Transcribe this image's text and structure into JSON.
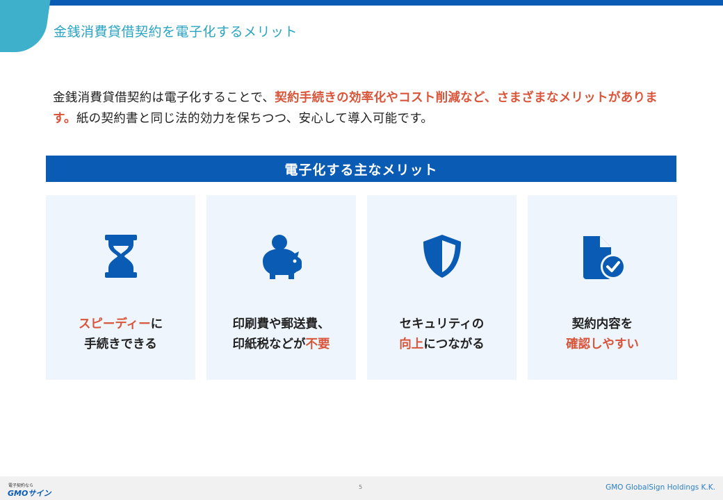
{
  "slide": {
    "title": "金銭消費貸借契約を電子化するメリット"
  },
  "intro": {
    "part1": "金銭消費貸借契約は電子化することで、",
    "highlight": "契約手続きの効率化やコスト削減など、さまざまなメリットがあります。",
    "part2": "紙の契約書と同じ法的効力を保ちつつ、安心して導入可能です。"
  },
  "section": {
    "heading": "電子化する主なメリット"
  },
  "cards": [
    {
      "icon": "hourglass-icon",
      "line1_hl": "スピーディー",
      "line1_rest": "に",
      "line2": "手続きできる"
    },
    {
      "icon": "piggy-bank-icon",
      "line1": "印刷費や郵送費、",
      "line2_pre": "印紙税などが",
      "line2_hl": "不要"
    },
    {
      "icon": "shield-icon",
      "line1": "セキュリティの",
      "line2_hl": "向上",
      "line2_rest": "につながる"
    },
    {
      "icon": "document-check-icon",
      "line1": "契約内容を",
      "line2_hl": "確認しやすい"
    }
  ],
  "footer": {
    "logo_small": "電子契約なら",
    "logo_main": "GMOサイン",
    "page_number": "5",
    "company": "GMO GlobalSign Holdings K.K."
  },
  "colors": {
    "brand_blue": "#0a5bb4",
    "title_teal": "#2aa4c4",
    "accent_red": "#d9553a",
    "card_bg": "#eef5fc"
  }
}
